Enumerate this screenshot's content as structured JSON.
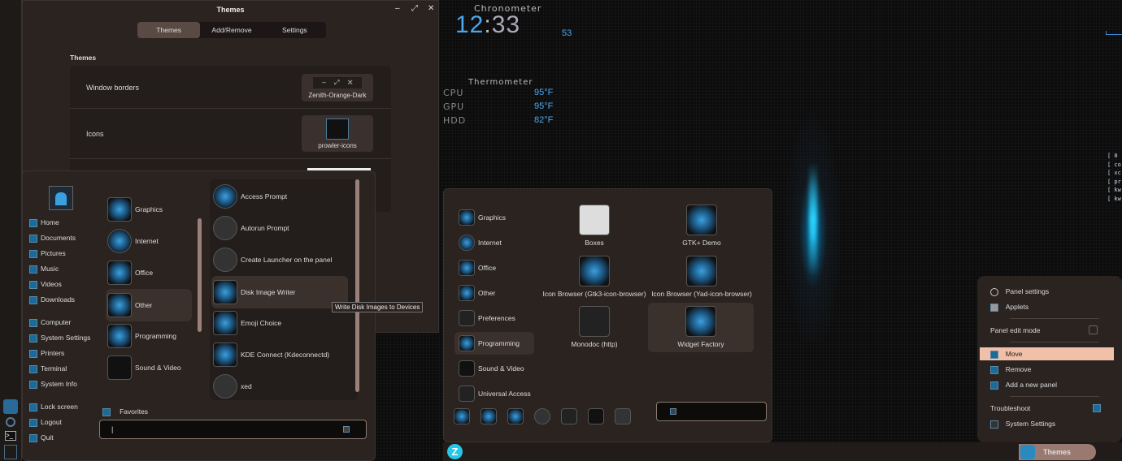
{
  "desktop": {
    "chronometer_label": "Chronometer",
    "clock_hours": "12",
    "clock_minutes": "33",
    "clock_seconds": "53",
    "thermometer_label": "Thermometer",
    "sensors": [
      {
        "name": "CPU",
        "value": "95°F"
      },
      {
        "name": "GPU",
        "value": "95°F"
      },
      {
        "name": "HDD",
        "value": "82°F"
      }
    ],
    "terminal_lines": [
      "[ 0",
      "[ co",
      "[ xc",
      "[ pr",
      "[ kw",
      "[ kw"
    ]
  },
  "themes_window": {
    "title": "Themes",
    "controls": [
      "–",
      "⤢",
      "✕"
    ],
    "tabs": [
      {
        "label": "Themes",
        "selected": true
      },
      {
        "label": "Add/Remove"
      },
      {
        "label": "Settings"
      }
    ],
    "section": "Themes",
    "rows": [
      {
        "label": "Window borders",
        "value": "Zenith-Orange-Dark"
      },
      {
        "label": "Icons",
        "value": "prowler-icons"
      }
    ]
  },
  "menu_left": {
    "places": [
      "Home",
      "Documents",
      "Pictures",
      "Music",
      "Videos",
      "Downloads"
    ],
    "system": [
      "Computer",
      "System Settings",
      "Printers",
      "Terminal",
      "System Info"
    ],
    "session": [
      "Lock screen",
      "Logout",
      "Quit"
    ],
    "categories": [
      "Graphics",
      "Internet",
      "Office",
      "Other",
      "Programming",
      "Sound & Video"
    ],
    "selected_category": "Other",
    "apps": [
      "Access Prompt",
      "Autorun Prompt",
      "Create Launcher on the panel",
      "Disk Image Writer",
      "Emoji Choice",
      "KDE Connect (Kdeconnectd)",
      "xed"
    ],
    "favorites_label": "Favorites",
    "search_value": "|",
    "tooltip": "Write Disk Images to Devices"
  },
  "menu_right": {
    "categories": [
      "Graphics",
      "Internet",
      "Office",
      "Other",
      "Preferences",
      "Programming",
      "Sound & Video",
      "Universal Access"
    ],
    "selected_category": "Programming",
    "apps": [
      "Boxes",
      "GTK+ Demo",
      "Icon Browser (Gtk3-icon-browser)",
      "Icon Browser (Yad-icon-browser)",
      "Monodoc (http)",
      "Widget Factory"
    ]
  },
  "context_menu": {
    "items": [
      "Panel settings",
      "Applets"
    ],
    "edit_mode": "Panel edit mode",
    "edit_mode_on": false,
    "panel_items": [
      "Move",
      "Remove",
      "Add a new panel"
    ],
    "highlighted": "Move",
    "troubleshoot": "Troubleshoot",
    "system_settings": "System Settings"
  },
  "panel": {
    "window_button": "Themes"
  },
  "colors": {
    "accent": "#f0c0a8",
    "clock_blue": "#4aa8f0"
  }
}
